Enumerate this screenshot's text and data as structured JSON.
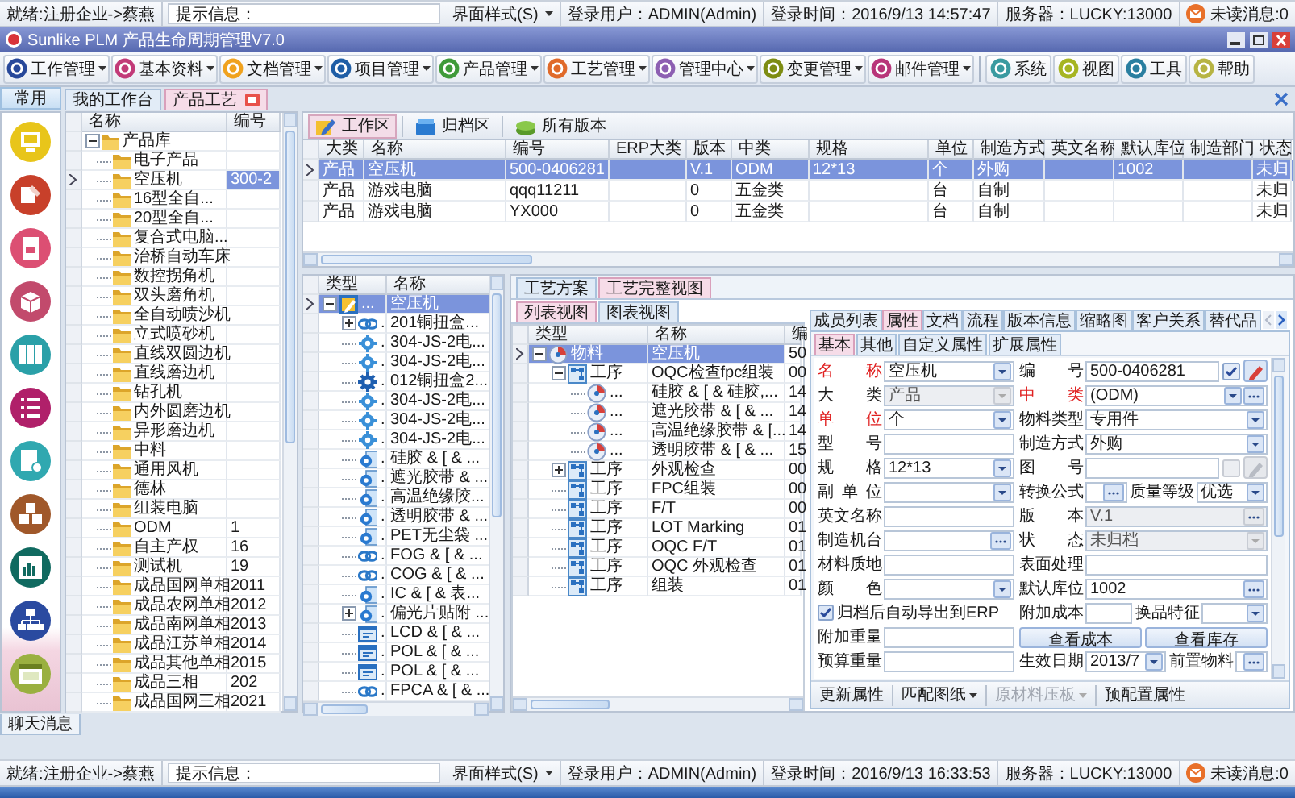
{
  "status_bar_top": {
    "ready": "就绪:注册企业->蔡燕",
    "hint": "提示信息：",
    "style_menu": "界面样式(S)",
    "user": "登录用户：ADMIN(Admin)",
    "login_time": "登录时间：2016/9/13 14:57:47",
    "server": "服务器：LUCKY:13000",
    "messages": "未读消息:0"
  },
  "window": {
    "title": "Sunlike PLM 产品生命周期管理V7.0"
  },
  "menubar": {
    "menus": [
      {
        "label": "工作管理",
        "color": "#27489a"
      },
      {
        "label": "基本资料",
        "color": "#c23a78"
      },
      {
        "label": "文档管理",
        "color": "#f0a21e"
      },
      {
        "label": "项目管理",
        "color": "#1f5ea6"
      },
      {
        "label": "产品管理",
        "color": "#3f9a3a"
      },
      {
        "label": "工艺管理",
        "color": "#e06a2a"
      },
      {
        "label": "管理中心",
        "color": "#8d5fb2"
      },
      {
        "label": "变更管理",
        "color": "#7d8c12"
      },
      {
        "label": "邮件管理",
        "color": "#b8357a"
      }
    ],
    "tools": [
      {
        "label": "系统",
        "color": "#3a9aa0"
      },
      {
        "label": "视图",
        "color": "#a6b522"
      },
      {
        "label": "工具",
        "color": "#2a7fa0"
      },
      {
        "label": "帮助",
        "color": "#b7b443"
      }
    ]
  },
  "launcher": {
    "header": "常用"
  },
  "doc_tabs": [
    {
      "label": "我的工作台",
      "selected": false,
      "closable": false
    },
    {
      "label": "产品工艺",
      "selected": true,
      "closable": true
    }
  ],
  "product_tree": {
    "columns": [
      "名称",
      "编号"
    ],
    "root": {
      "name": "产品库",
      "expanded": true,
      "selected": false,
      "children": [
        {
          "name": "电子产品",
          "selected": false
        },
        {
          "name": "空压机",
          "code": "300-2",
          "selected": true
        },
        {
          "name": "16型全自...",
          "selected": false
        },
        {
          "name": "20型全自...",
          "selected": false
        },
        {
          "name": "复合式电脑...",
          "selected": false
        },
        {
          "name": "治桥自动车床",
          "selected": false
        },
        {
          "name": "数控拐角机",
          "selected": false
        },
        {
          "name": "双头磨角机",
          "selected": false
        },
        {
          "name": "全自动喷沙机",
          "selected": false
        },
        {
          "name": "立式喷砂机",
          "selected": false
        },
        {
          "name": "直线双圆边机",
          "selected": false
        },
        {
          "name": "直线磨边机",
          "selected": false
        },
        {
          "name": "钻孔机",
          "selected": false
        },
        {
          "name": "内外圆磨边机",
          "selected": false
        },
        {
          "name": "异形磨边机",
          "selected": false
        },
        {
          "name": "中料",
          "selected": false
        },
        {
          "name": "通用风机",
          "selected": false
        },
        {
          "name": "德林",
          "selected": false
        },
        {
          "name": "组装电脑",
          "selected": false
        },
        {
          "name": "ODM",
          "code": "1",
          "selected": false
        },
        {
          "name": "自主产权",
          "code": "16",
          "selected": false
        },
        {
          "name": "测试机",
          "code": "19",
          "selected": false
        },
        {
          "name": "成品国网单相",
          "code": "2011",
          "selected": false
        },
        {
          "name": "成品农网单相",
          "code": "2012",
          "selected": false
        },
        {
          "name": "成品南网单相",
          "code": "2013",
          "selected": false
        },
        {
          "name": "成品江苏单相",
          "code": "2014",
          "selected": false
        },
        {
          "name": "成品其他单相",
          "code": "2015",
          "selected": false
        },
        {
          "name": "成品三相",
          "code": "202",
          "selected": false
        },
        {
          "name": "成品国网三相",
          "code": "2021",
          "selected": false
        }
      ]
    }
  },
  "work_toolbar": [
    {
      "label": "工作区",
      "selected": true
    },
    {
      "label": "归档区",
      "selected": false
    },
    {
      "label": "所有版本",
      "selected": false
    }
  ],
  "items_table": {
    "columns": [
      "大类",
      "名称",
      "编号",
      "ERP大类",
      "版本",
      "中类",
      "规格",
      "单位",
      "制造方式",
      "英文名称",
      "默认库位",
      "制造部门",
      "状态"
    ],
    "rows": [
      {
        "selected": true,
        "cells": [
          "产品",
          "空压机",
          "500-0406281",
          null,
          "V.1",
          "ODM",
          "12*13",
          "个",
          "外购",
          null,
          "1002",
          null,
          "未归"
        ]
      },
      {
        "selected": false,
        "cells": [
          "产品",
          "游戏电脑",
          "qqq11211",
          null,
          "0",
          "五金类",
          null,
          "台",
          "自制",
          null,
          null,
          null,
          "未归"
        ]
      },
      {
        "selected": false,
        "cells": [
          "产品",
          "游戏电脑",
          "YX000",
          null,
          "0",
          "五金类",
          null,
          "台",
          "自制",
          null,
          null,
          null,
          "未归"
        ]
      }
    ]
  },
  "route_tree": {
    "columns": [
      "类型",
      "名称"
    ],
    "root": {
      "kind": "edit",
      "type": "...",
      "name": "空压机",
      "selected": true,
      "expanded": true,
      "children": [
        {
          "kind": "chain",
          "type": ".",
          "name": "201铜扭盒...",
          "selected": false,
          "expanded": false
        },
        {
          "kind": "cog",
          "type": ".",
          "name": "304-JS-2电...",
          "selected": false
        },
        {
          "kind": "cog",
          "type": ".",
          "name": "304-JS-2电...",
          "selected": false
        },
        {
          "kind": "gear",
          "type": ".",
          "name": "012铜扭盒2...",
          "selected": false
        },
        {
          "kind": "cog",
          "type": ".",
          "name": "304-JS-2电...",
          "selected": false
        },
        {
          "kind": "cog",
          "type": ".",
          "name": "304-JS-2电...",
          "selected": false
        },
        {
          "kind": "cog",
          "type": ".",
          "name": "304-JS-2电...",
          "selected": false
        },
        {
          "kind": "part",
          "type": ".",
          "name": "硅胶 & [ & ...",
          "selected": false
        },
        {
          "kind": "part",
          "type": ".",
          "name": "遮光胶带 & ...",
          "selected": false
        },
        {
          "kind": "part",
          "type": ".",
          "name": "高温绝缘胶...",
          "selected": false
        },
        {
          "kind": "part",
          "type": ".",
          "name": "透明胶带 & ...",
          "selected": false
        },
        {
          "kind": "part",
          "type": ".",
          "name": "PET无尘袋 ...",
          "selected": false
        },
        {
          "kind": "chain",
          "type": ".",
          "name": "FOG & [ & ...",
          "selected": false
        },
        {
          "kind": "chain",
          "type": ".",
          "name": "COG & [ & ...",
          "selected": false
        },
        {
          "kind": "part",
          "type": ".",
          "name": "IC & [ & 表...",
          "selected": false
        },
        {
          "kind": "part",
          "type": ".",
          "name": "偏光片贴附 ...",
          "selected": false,
          "expanded": false
        },
        {
          "kind": "panel",
          "type": ".",
          "name": "LCD & [ & ...",
          "selected": false
        },
        {
          "kind": "panel",
          "type": ".",
          "name": "POL & [ & ...",
          "selected": false
        },
        {
          "kind": "panel",
          "type": ".",
          "name": "POL & [ & ...",
          "selected": false
        },
        {
          "kind": "chain",
          "type": ".",
          "name": "FPCA & [ & ...",
          "selected": false
        }
      ]
    }
  },
  "process_view": {
    "tabs": [
      {
        "label": "工艺方案",
        "selected": false
      },
      {
        "label": "工艺完整视图",
        "selected": true
      }
    ],
    "view_tabs": [
      {
        "label": "列表视图",
        "selected": true
      },
      {
        "label": "图表视图",
        "selected": false
      }
    ],
    "columns": [
      "类型",
      "名称",
      "编"
    ],
    "root": {
      "kind": "material",
      "type": "物料",
      "name": "空压机",
      "code": "50",
      "selected": true,
      "expanded": true,
      "children": [
        {
          "kind": "process",
          "type": "工序",
          "name": "OQC检查fpc组装",
          "code": "00",
          "selected": false,
          "expanded": true,
          "children": [
            {
              "kind": "material",
              "type": "...",
              "name": "硅胶 & [ & 硅胶,...",
              "code": "14",
              "selected": false
            },
            {
              "kind": "material",
              "type": "...",
              "name": "遮光胶带 & [ & ...",
              "code": "14",
              "selected": false
            },
            {
              "kind": "material",
              "type": "...",
              "name": "高温绝缘胶带 & [...",
              "code": "14",
              "selected": false
            },
            {
              "kind": "material",
              "type": "...",
              "name": "透明胶带 & [ & ...",
              "code": "15",
              "selected": false
            }
          ]
        },
        {
          "kind": "process",
          "type": "工序",
          "name": "外观检查",
          "code": "00",
          "selected": false,
          "expanded": false
        },
        {
          "kind": "process",
          "type": "工序",
          "name": "FPC组装",
          "code": "00",
          "selected": false
        },
        {
          "kind": "process",
          "type": "工序",
          "name": "F/T",
          "code": "00",
          "selected": false
        },
        {
          "kind": "process",
          "type": "工序",
          "name": "LOT Marking",
          "code": "01",
          "selected": false
        },
        {
          "kind": "process",
          "type": "工序",
          "name": "OQC F/T",
          "code": "01",
          "selected": false
        },
        {
          "kind": "process",
          "type": "工序",
          "name": "OQC 外观检查",
          "code": "01",
          "selected": false
        },
        {
          "kind": "process",
          "type": "工序",
          "name": "组装",
          "code": "01",
          "selected": false
        }
      ]
    }
  },
  "properties": {
    "tabs": [
      {
        "label": "成员列表",
        "selected": false
      },
      {
        "label": "属性",
        "selected": true
      },
      {
        "label": "文档",
        "selected": false
      },
      {
        "label": "流程",
        "selected": false
      },
      {
        "label": "版本信息",
        "selected": false
      },
      {
        "label": "缩略图",
        "selected": false
      },
      {
        "label": "客户关系",
        "selected": false
      },
      {
        "label": "替代品",
        "selected": false
      }
    ],
    "sub_tabs": [
      {
        "label": "基本",
        "selected": true
      },
      {
        "label": "其他",
        "selected": false
      },
      {
        "label": "自定义属性",
        "selected": false
      },
      {
        "label": "扩展属性",
        "selected": false
      }
    ],
    "form": [
      {
        "left": [
          {
            "kind": "dropdown",
            "label": "名称",
            "required": true,
            "disabled": false,
            "value": "空压机"
          }
        ],
        "right": [
          {
            "kind": "text",
            "label": "编号",
            "required": false,
            "disabled": false,
            "value": "500-0406281"
          },
          {
            "kind": "check",
            "checked": true,
            "disabled": false
          },
          {
            "kind": "edit",
            "disabled": false
          }
        ]
      },
      {
        "left": [
          {
            "kind": "dropdown",
            "label": "大类",
            "required": false,
            "disabled": true,
            "value": "产品"
          }
        ],
        "right": [
          {
            "kind": "dropdown-ellipsis",
            "label": "中类",
            "required": true,
            "disabled": false,
            "value": "(ODM)"
          }
        ]
      },
      {
        "left": [
          {
            "kind": "dropdown",
            "label": "单位",
            "required": true,
            "disabled": false,
            "value": "个"
          }
        ],
        "right": [
          {
            "kind": "dropdown",
            "label": "物料类型",
            "required": false,
            "disabled": false,
            "value": "专用件"
          }
        ]
      },
      {
        "left": [
          {
            "kind": "text",
            "label": "型号",
            "required": false,
            "disabled": false
          }
        ],
        "right": [
          {
            "kind": "dropdown",
            "label": "制造方式",
            "required": false,
            "disabled": false,
            "value": "外购"
          }
        ]
      },
      {
        "left": [
          {
            "kind": "dropdown",
            "label": "规格",
            "required": false,
            "disabled": false,
            "value": "12*13"
          }
        ],
        "right": [
          {
            "kind": "text",
            "label": "图号",
            "required": false,
            "disabled": false
          },
          {
            "kind": "check",
            "checked": false,
            "disabled": true
          },
          {
            "kind": "edit",
            "disabled": true
          }
        ]
      },
      {
        "left": [
          {
            "kind": "dropdown",
            "label": "副单位",
            "required": false,
            "disabled": false
          }
        ],
        "right": [
          {
            "kind": "ellipsis",
            "label": "转换公式",
            "required": false,
            "disabled": false
          },
          {
            "kind": "dropdown",
            "label": "质量等级",
            "required": false,
            "disabled": false,
            "value": "优选"
          }
        ]
      },
      {
        "left": [
          {
            "kind": "text",
            "label": "英文名称",
            "required": false,
            "disabled": false
          }
        ],
        "right": [
          {
            "kind": "ellipsis",
            "label": "版本",
            "required": false,
            "disabled": true,
            "value": "V.1"
          }
        ]
      },
      {
        "left": [
          {
            "kind": "ellipsis",
            "label": "制造机台",
            "required": false,
            "disabled": false
          }
        ],
        "right": [
          {
            "kind": "dropdown",
            "label": "状态",
            "required": false,
            "disabled": true,
            "value": "未归档"
          }
        ]
      },
      {
        "left": [
          {
            "kind": "text",
            "label": "材料质地",
            "required": false,
            "disabled": false
          }
        ],
        "right": [
          {
            "kind": "text",
            "label": "表面处理",
            "required": false,
            "disabled": false
          }
        ]
      },
      {
        "left": [
          {
            "kind": "dropdown",
            "label": "颜色",
            "required": false,
            "disabled": false
          }
        ],
        "right": [
          {
            "kind": "ellipsis",
            "label": "默认库位",
            "required": false,
            "disabled": false,
            "value": "1002"
          }
        ]
      },
      {
        "left": [
          {
            "kind": "checkbox",
            "label": "归档后自动导出到ERP",
            "checked": true
          }
        ],
        "right": [
          {
            "kind": "text",
            "label": "附加成本",
            "required": false,
            "disabled": false
          },
          {
            "kind": "dropdown",
            "label": "换品特征",
            "required": false,
            "disabled": false
          }
        ]
      },
      {
        "left": [
          {
            "kind": "text",
            "label": "附加重量",
            "required": false,
            "disabled": false
          }
        ],
        "right": [
          {
            "kind": "button",
            "label": "查看成本"
          },
          {
            "kind": "button",
            "label": "查看库存"
          }
        ]
      },
      {
        "left": [
          {
            "kind": "text",
            "label": "预算重量",
            "required": false,
            "disabled": false
          }
        ],
        "right": [
          {
            "kind": "dropdown",
            "label": "生效日期",
            "required": false,
            "disabled": false,
            "value": "2013/7"
          },
          {
            "kind": "ellipsis",
            "label": "前置物料",
            "required": false,
            "disabled": false
          }
        ]
      }
    ],
    "actions": [
      {
        "label": "更新属性",
        "dropdown": false,
        "disabled": false
      },
      {
        "label": "匹配图纸",
        "dropdown": true,
        "disabled": false
      },
      {
        "label": "原材料压板",
        "dropdown": true,
        "disabled": true
      },
      {
        "label": "预配置属性",
        "dropdown": false,
        "disabled": false
      }
    ]
  },
  "chat_tab": {
    "label": "聊天消息"
  },
  "status_bar_bottom": {
    "ready": "就绪:注册企业->蔡燕",
    "hint": "提示信息：",
    "style_menu": "界面样式(S)",
    "user": "登录用户：ADMIN(Admin)",
    "login_time": "登录时间：2016/9/13 16:33:53",
    "server": "服务器：LUCKY:13000",
    "messages": "未读消息:0"
  }
}
